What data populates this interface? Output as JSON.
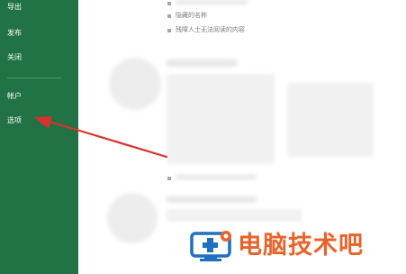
{
  "sidebar": {
    "items": [
      {
        "label": "导出"
      },
      {
        "label": "发布"
      },
      {
        "label": "关闭"
      },
      {
        "label": "帐户"
      },
      {
        "label": "选项"
      }
    ]
  },
  "main": {
    "bullets": [
      {
        "text": "隐藏的名称"
      },
      {
        "text": "残障人士无法阅读的内容"
      }
    ]
  },
  "watermark": {
    "text": "电脑技术吧",
    "brand_color": "#e8632a",
    "icon_color": "#1f6fc1"
  },
  "colors": {
    "sidebar": "#217346",
    "arrow": "#d9312c"
  }
}
